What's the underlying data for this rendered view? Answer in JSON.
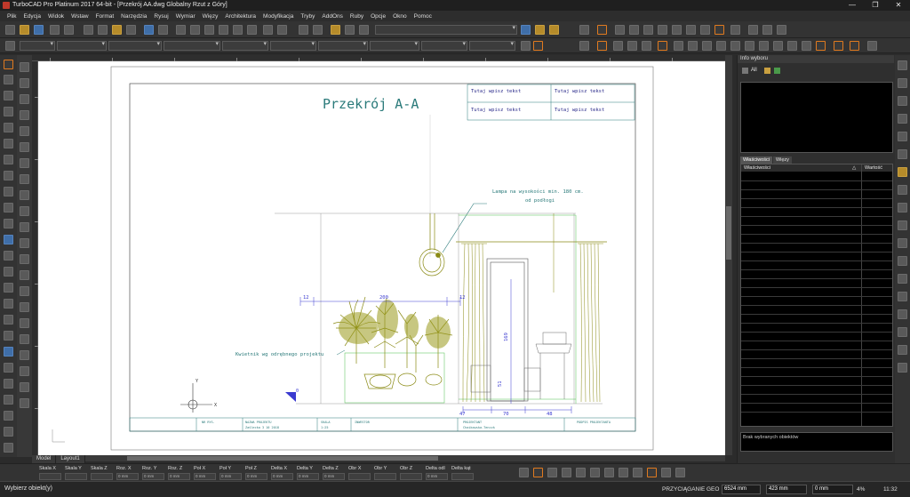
{
  "window": {
    "title": "TurboCAD Pro Platinum 2017 64-bit - [Przekrój AA.dwg Globalny Rzut z Góry]",
    "controls": [
      "—",
      "❐",
      "✕"
    ]
  },
  "menu": [
    "Plik",
    "Edycja",
    "Widok",
    "Wstaw",
    "Format",
    "Narzędzia",
    "Rysuj",
    "Wymiar",
    "Więzy",
    "Architektura",
    "Modyfikacja",
    "Tryby",
    "AddOns",
    "Ruby",
    "Opcje",
    "Okno",
    "Pomoc"
  ],
  "drawing": {
    "title": "Przekrój A-A",
    "text_cells": [
      "Tutaj wpisz tekst",
      "Tutaj wpisz tekst",
      "Tutaj wpisz tekst",
      "Tutaj wpisz tekst"
    ],
    "lamp_note_line1": "Lampa na wysokości min. 180 cm.",
    "lamp_note_line2": "od podłogi",
    "flower_note": "Kwietnik wg odrębnego projektu",
    "dims": {
      "d12a": "12",
      "d200": "200",
      "d12b": "12",
      "d169": "169",
      "d51": "51",
      "d47": "47",
      "d70": "70",
      "d48": "48",
      "d0": "0"
    },
    "titleblock": {
      "nr_label": "NR RYS.",
      "name_label": "NAZWA PROJEKTU",
      "name_value": "Zaślecka 3 10 2018",
      "scale_label": "SKALA",
      "scale_value": "1:25",
      "investor_label": "INWESTOR",
      "designer_label": "PROJEKTANT",
      "designer_value": "Chaikowska-Tenczk",
      "sign_label": "PODPIS PROJEKTANTA"
    },
    "ucs": {
      "y": "Y",
      "x": "X"
    }
  },
  "tabs": [
    "Model",
    "Layout1"
  ],
  "right_panel": {
    "title": "Info wyboru",
    "all_label": "All",
    "tabs": [
      "Właściwości",
      "Więzy"
    ],
    "col1": "Właściwości",
    "col2": "Wartość",
    "no_selection": "Brak wybranych obiektów"
  },
  "coord_labels": [
    "Skala X",
    "Skala Y",
    "Skala Z",
    "Roz. X",
    "Roz. Y",
    "Roz. Z",
    "Poł X",
    "Poł Y",
    "Poł Z",
    "Delta X",
    "Delta Y",
    "Delta Z",
    "Obr X",
    "Obr Y",
    "Obr Z",
    "Delta odl",
    "Delta kąt"
  ],
  "coord_values": [
    "",
    "",
    "",
    "0 mm",
    "0 mm",
    "0 mm",
    "0 mm",
    "0 mm",
    "0 mm",
    "0 mm",
    "0 mm",
    "0 mm",
    "",
    "",
    "",
    "0 mm",
    ""
  ],
  "status": {
    "message": "Wybierz obiekt(y)",
    "snap": "PRZYCIĄGANIE",
    "geo": "GEO",
    "x_value": "6524 mm",
    "y_value": "423 mm",
    "z_value": "0 mm",
    "zoom": "4%",
    "time": "11:32"
  },
  "colors": {
    "drawing_teal": "#2a7a7a",
    "plant_olive": "#8a8a14",
    "dim_blue": "#3a3ad0",
    "accent_orange": "#e07a1f",
    "dark_bg": "#2b2b2b"
  }
}
